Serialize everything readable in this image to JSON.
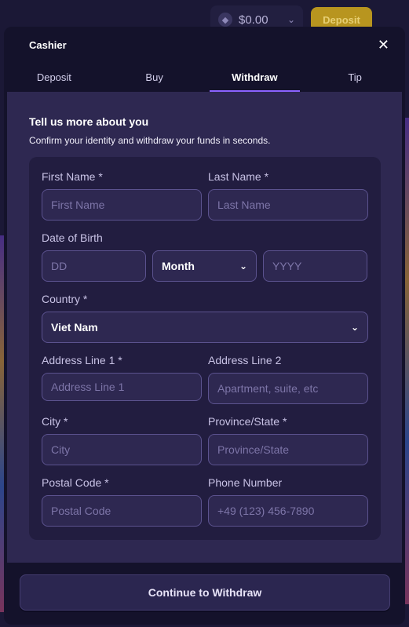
{
  "topbar": {
    "balance": "$0.00",
    "deposit_label": "Deposit"
  },
  "modal": {
    "title": "Cashier",
    "tabs": [
      {
        "label": "Deposit",
        "active": false
      },
      {
        "label": "Buy",
        "active": false
      },
      {
        "label": "Withdraw",
        "active": true
      },
      {
        "label": "Tip",
        "active": false
      }
    ]
  },
  "intro": {
    "heading": "Tell us more about you",
    "subtext": "Confirm your identity and withdraw your funds in seconds."
  },
  "form": {
    "first_name": {
      "label": "First Name *",
      "placeholder": "First Name"
    },
    "last_name": {
      "label": "Last Name *",
      "placeholder": "Last Name"
    },
    "dob": {
      "label": "Date of Birth",
      "day_placeholder": "DD",
      "month_value": "Month",
      "year_placeholder": "YYYY"
    },
    "country": {
      "label": "Country *",
      "value": "Viet Nam"
    },
    "address1": {
      "label": "Address Line 1 *",
      "placeholder": "Address Line 1"
    },
    "address2": {
      "label": "Address Line 2",
      "placeholder": "Apartment, suite, etc"
    },
    "city": {
      "label": "City *",
      "placeholder": "City"
    },
    "province": {
      "label": "Province/State *",
      "placeholder": "Province/State"
    },
    "postal": {
      "label": "Postal Code *",
      "placeholder": "Postal Code"
    },
    "phone": {
      "label": "Phone Number",
      "placeholder": "+49 (123) 456-7890"
    }
  },
  "footer": {
    "continue_label": "Continue to Withdraw"
  },
  "colors": {
    "accent": "#8b63ff",
    "modal_bg": "#14122b",
    "panel_bg": "#2e2851",
    "card_bg": "#221d40",
    "deposit_gold": "#b8951f"
  }
}
